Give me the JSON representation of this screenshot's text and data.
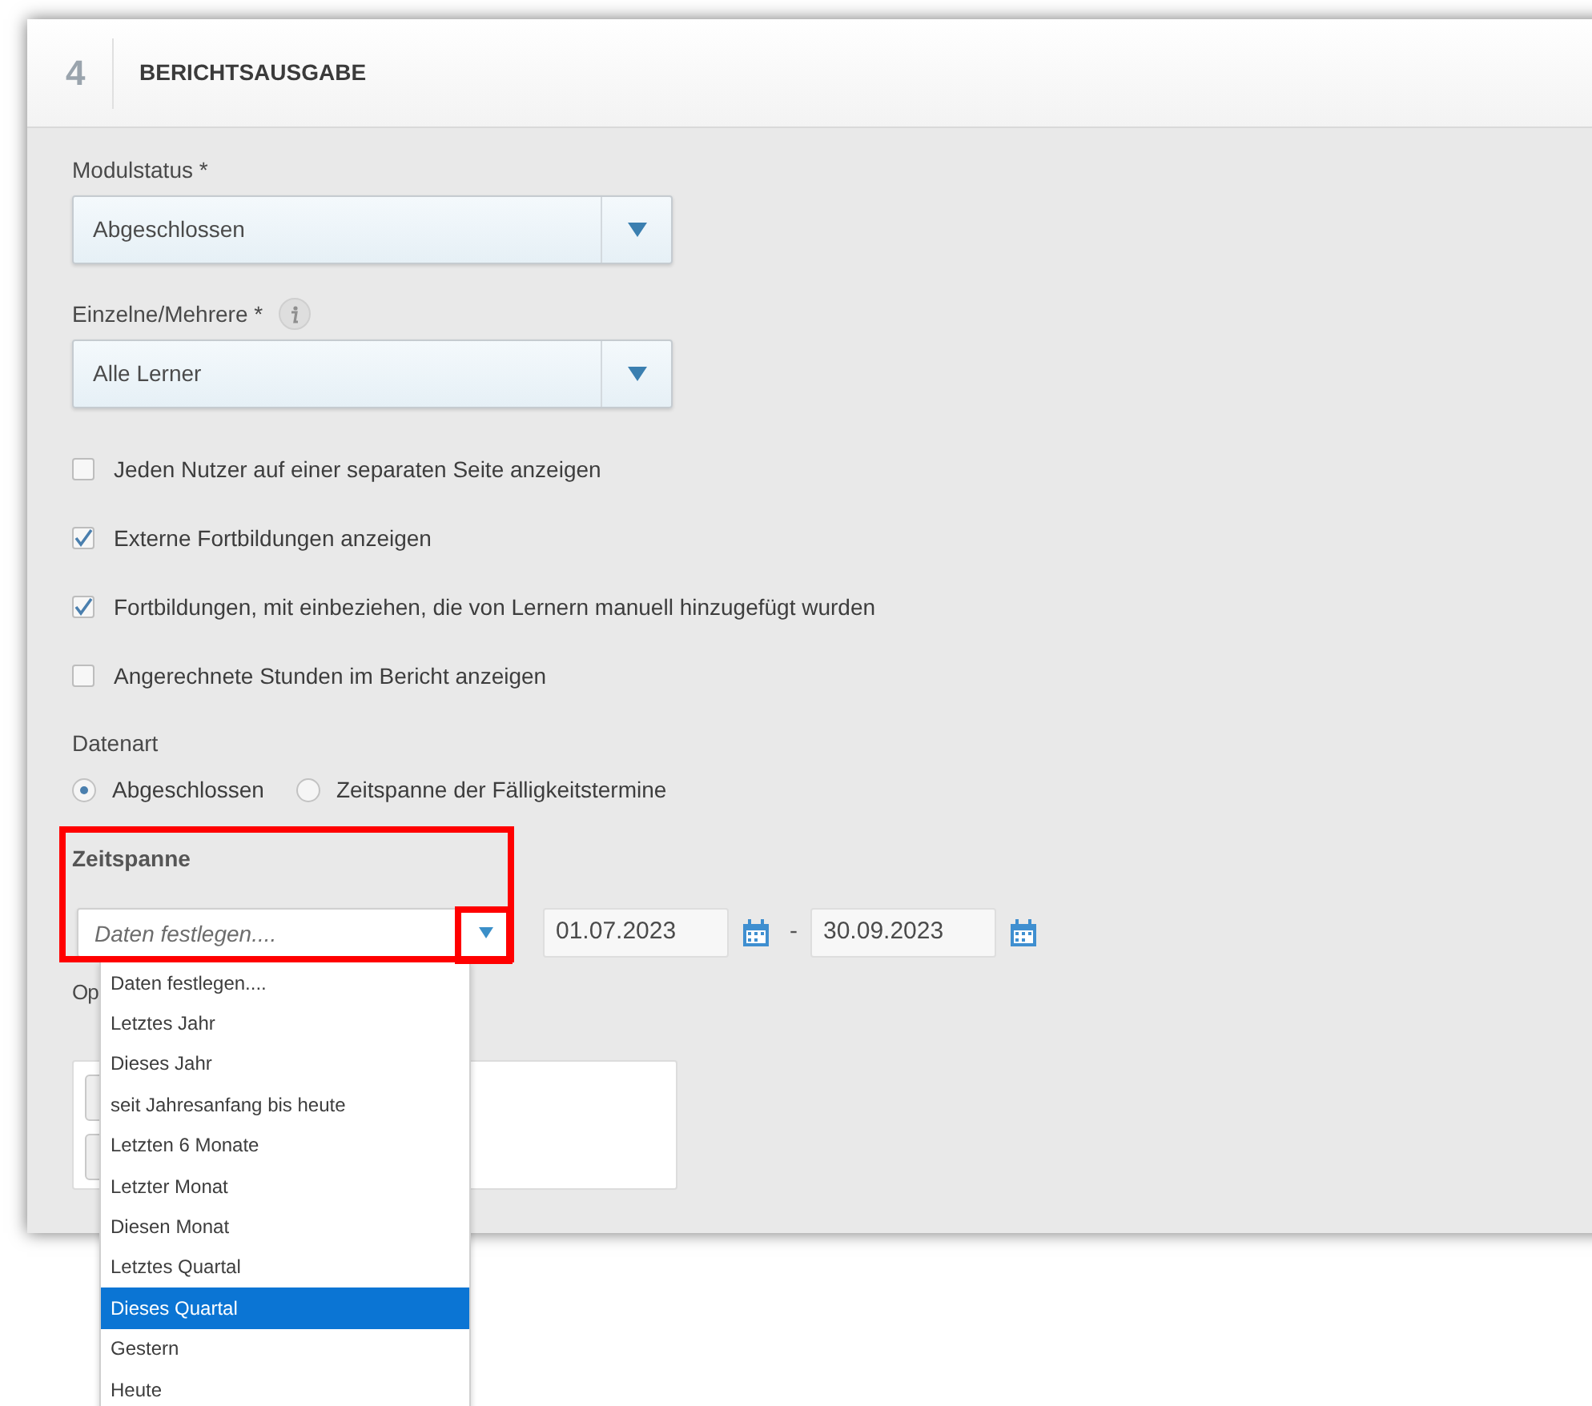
{
  "section": {
    "number": "4",
    "title": "BERICHTSAUSGABE"
  },
  "fields": [
    {
      "label": "Modulstatus *",
      "info": false,
      "value": "Abgeschlossen"
    },
    {
      "label": "Einzelne/Mehrere *",
      "info": true,
      "value": "Alle Lerner"
    }
  ],
  "checkboxes": [
    {
      "label": "Jeden Nutzer auf einer separaten Seite anzeigen",
      "checked": false
    },
    {
      "label": "Externe Fortbildungen anzeigen",
      "checked": true
    },
    {
      "label": "Fortbildungen, mit einbeziehen, die von Lernern manuell hinzugefügt wurden",
      "checked": true
    },
    {
      "label": "Angerechnete Stunden im Bericht anzeigen",
      "checked": false
    }
  ],
  "date_type": {
    "label": "Datenart",
    "options": [
      {
        "label": "Abgeschlossen",
        "selected": true
      },
      {
        "label": "Zeitspanne der Fälligkeitstermine",
        "selected": false
      }
    ]
  },
  "period": {
    "label": "Zeitspanne",
    "highlighted": true,
    "arrow_highlighted": true,
    "placeholder": "Daten festlegen....",
    "from": "01.07.2023",
    "separator": "-",
    "to": "30.09.2023",
    "expanded": true,
    "options": [
      {
        "label": "Daten festlegen....",
        "selected": false
      },
      {
        "label": "Letztes Jahr",
        "selected": false
      },
      {
        "label": "Dieses Jahr",
        "selected": false
      },
      {
        "label": "seit Jahresanfang bis heute",
        "selected": false
      },
      {
        "label": "Letzten 6 Monate",
        "selected": false
      },
      {
        "label": "Letzter Monat",
        "selected": false
      },
      {
        "label": "Diesen Monat",
        "selected": false
      },
      {
        "label": "Letztes Quartal",
        "selected": false
      },
      {
        "label": "Dieses Quartal",
        "selected": true
      },
      {
        "label": "Gestern",
        "selected": false
      },
      {
        "label": "Heute",
        "selected": false
      }
    ]
  },
  "next_section": {
    "label": "Op"
  }
}
